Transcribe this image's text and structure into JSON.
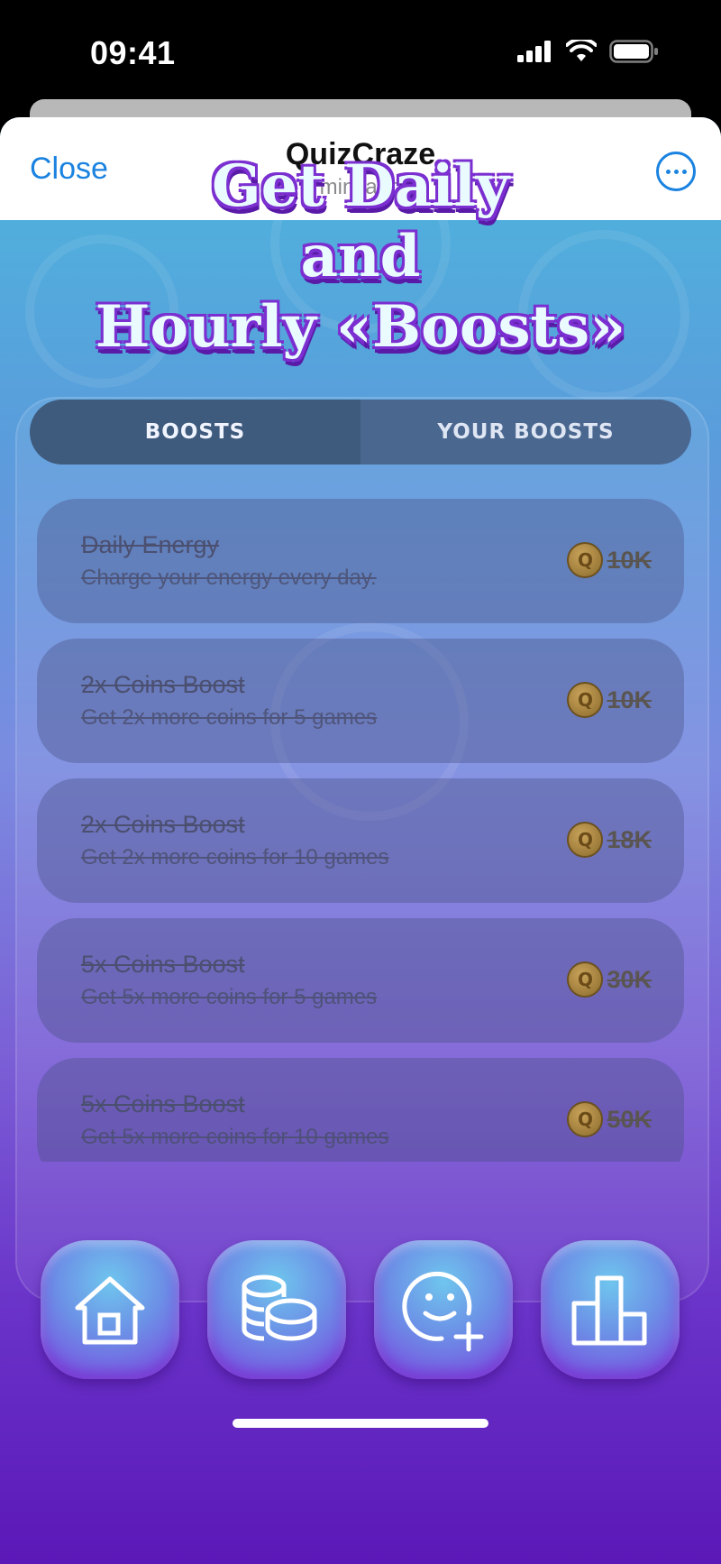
{
  "status": {
    "time": "09:41"
  },
  "nav": {
    "close_label": "Close",
    "title": "QuizCraze",
    "subtitle": "mini app",
    "more_icon": "ellipsis-circle-icon"
  },
  "headline": {
    "line1": "Get Daily",
    "line2": "and",
    "line3": "Hourly «Boosts»"
  },
  "tabs": [
    {
      "label": "BOOSTS",
      "active": true
    },
    {
      "label": "YOUR BOOSTS",
      "active": false
    }
  ],
  "boosts": [
    {
      "title": "Daily Energy",
      "description": "Charge your energy every day.",
      "price": "10K"
    },
    {
      "title": "2x Coins Boost",
      "description": "Get 2x more coins for 5 games",
      "price": "10K"
    },
    {
      "title": "2x Coins Boost",
      "description": "Get 2x more coins for 10 games",
      "price": "18K"
    },
    {
      "title": "5x Coins Boost",
      "description": "Get 5x more coins for 5 games",
      "price": "30K"
    },
    {
      "title": "5x Coins Boost",
      "description": "Get 5x more coins for 10 games",
      "price": "50K"
    }
  ],
  "coin_symbol": "Q",
  "bottom_nav": [
    {
      "icon": "home-icon"
    },
    {
      "icon": "coins-icon"
    },
    {
      "icon": "add-friend-icon"
    },
    {
      "icon": "leaderboard-icon"
    }
  ],
  "colors": {
    "accent": "#1a82e0",
    "headline_outline": "#7b2fd0"
  }
}
